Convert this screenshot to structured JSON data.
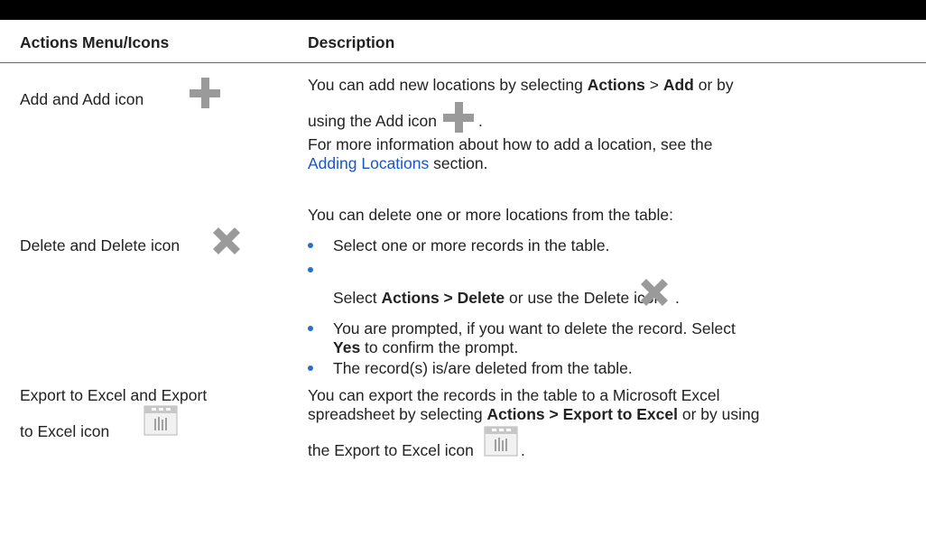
{
  "table": {
    "headers": {
      "col1": "Actions Menu/Icons",
      "col2": "Description"
    },
    "rows": [
      {
        "action": "Add and Add icon",
        "icon": "add-icon",
        "desc_line1": {
          "pre": "You can add new locations by selecting ",
          "b1": "Actions",
          "mid": " > ",
          "b2": "Add",
          "post": " or by"
        },
        "desc_line2": {
          "pre": "using the Add icon",
          "post": "."
        },
        "desc_line3": "For more information about how to add a location, see the",
        "desc_line4": {
          "link": "Adding Locations",
          "post": " section."
        }
      },
      {
        "action": "Delete and Delete icon",
        "icon": "delete-icon",
        "intro": "You can delete one or more locations from the table:",
        "bullets": {
          "b1": "Select one or more records in the table.",
          "b2": {
            "pre": "Select ",
            "bold": "Actions > Delete",
            "post": " or use the Delete icon",
            "end": "."
          },
          "b3_line1": "You are prompted, if you want to delete the record. Select",
          "b3_line2": {
            "bold": "Yes",
            "post": " to confirm the prompt."
          },
          "b4": "The record(s) is/are deleted from the table."
        }
      },
      {
        "action_line1": "Export to Excel and Export",
        "action_line2": "to Excel icon",
        "icon": "excel-icon",
        "desc_line1": "You can export the records in the table to a Microsoft Excel",
        "desc_line2": {
          "pre": "spreadsheet by selecting ",
          "bold": "Actions > Export to Excel",
          "post": " or by using"
        },
        "desc_line3": {
          "pre": "the Export to Excel icon",
          "post": "."
        }
      }
    ]
  },
  "colors": {
    "bullet": "#2a6fc9",
    "link": "#1a55c9",
    "icon_gray": "#9a9a9a"
  }
}
